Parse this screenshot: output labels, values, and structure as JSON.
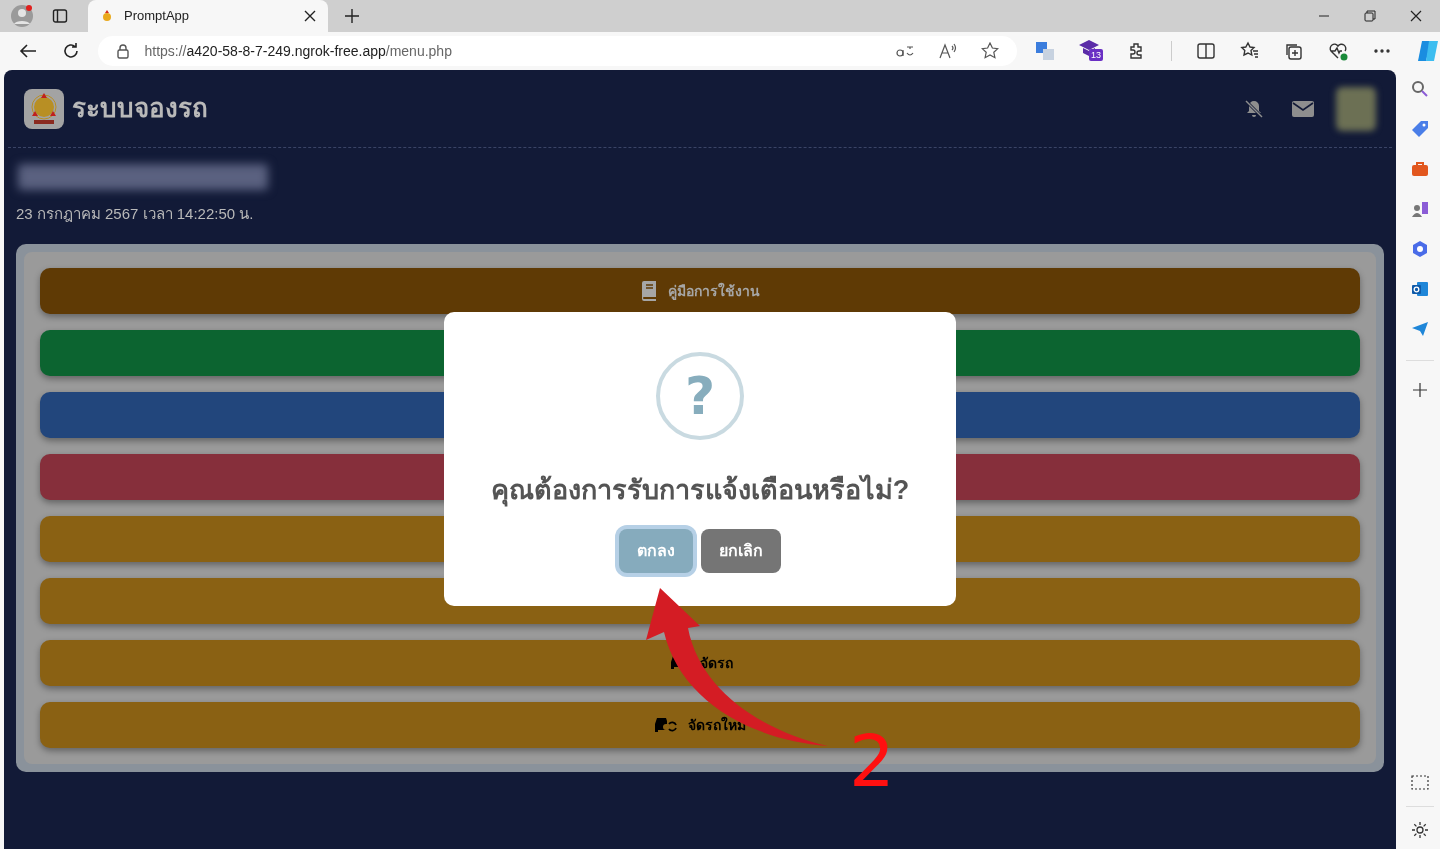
{
  "browser": {
    "tab": {
      "title": "PromptApp",
      "selected": true
    },
    "url": {
      "scheme": "https://",
      "host": "a420-58-8-7-249.ngrok-free.app",
      "path": "/menu.php"
    },
    "extension_badge": "13"
  },
  "app": {
    "title": "ระบบจองรถ",
    "date": "23 กรกฎาคม 2567 เวลา 14:22:50 น.",
    "menu": [
      {
        "kind": "book",
        "label": "คู่มือการใช้งาน",
        "color": "#5f3a05"
      },
      {
        "kind": "hidden",
        "color": "#0c6430"
      },
      {
        "kind": "hidden",
        "color": "#22467c"
      },
      {
        "kind": "hidden",
        "color": "#862f3b"
      },
      {
        "kind": "hidden",
        "color": "#8a6113"
      },
      {
        "kind": "hidden",
        "color": "#8a6113"
      },
      {
        "kind": "car",
        "label": "จัดรถ",
        "color": "#8a6113"
      },
      {
        "kind": "car-refresh",
        "label": "จัดรถใหม่",
        "color": "#8a6113"
      }
    ]
  },
  "dialog": {
    "icon": "?",
    "question": "คุณต้องการรับการแจ้งเตือนหรือไม่?",
    "buttons": [
      {
        "label": "ตกลง",
        "kind": "confirm",
        "focused": true
      },
      {
        "label": "ยกเลิก",
        "kind": "cancel",
        "focused": false
      }
    ]
  },
  "annotation": {
    "step": "2"
  }
}
